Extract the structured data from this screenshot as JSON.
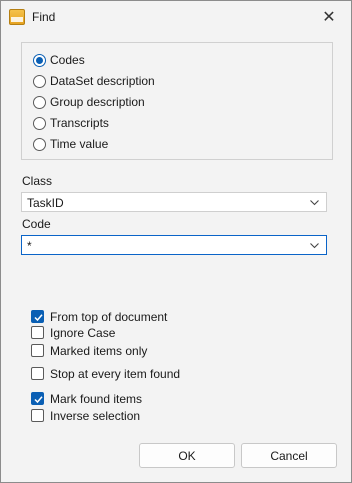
{
  "window": {
    "title": "Find",
    "app_icon": "app-icon",
    "close_glyph": "✕"
  },
  "search_in": {
    "options": [
      {
        "label": "Codes",
        "checked": true
      },
      {
        "label": "DataSet description",
        "checked": false
      },
      {
        "label": "Group description",
        "checked": false
      },
      {
        "label": "Transcripts",
        "checked": false
      },
      {
        "label": "Time value",
        "checked": false
      }
    ]
  },
  "class_field": {
    "label": "Class",
    "value": "TaskID"
  },
  "code_field": {
    "label": "Code",
    "value": "*"
  },
  "options": {
    "from_top": {
      "label": "From top of document",
      "checked": true
    },
    "ignore_case": {
      "label": "Ignore Case",
      "checked": false
    },
    "marked_only": {
      "label": "Marked items only",
      "checked": false
    },
    "stop_every": {
      "label": "Stop at every item found",
      "checked": false
    },
    "mark_found": {
      "label": "Mark found items",
      "checked": true
    },
    "inverse": {
      "label": "Inverse selection",
      "checked": false
    }
  },
  "buttons": {
    "ok": "OK",
    "cancel": "Cancel"
  },
  "colors": {
    "accent": "#0a5fb4",
    "focus_border": "#0a64c8"
  }
}
